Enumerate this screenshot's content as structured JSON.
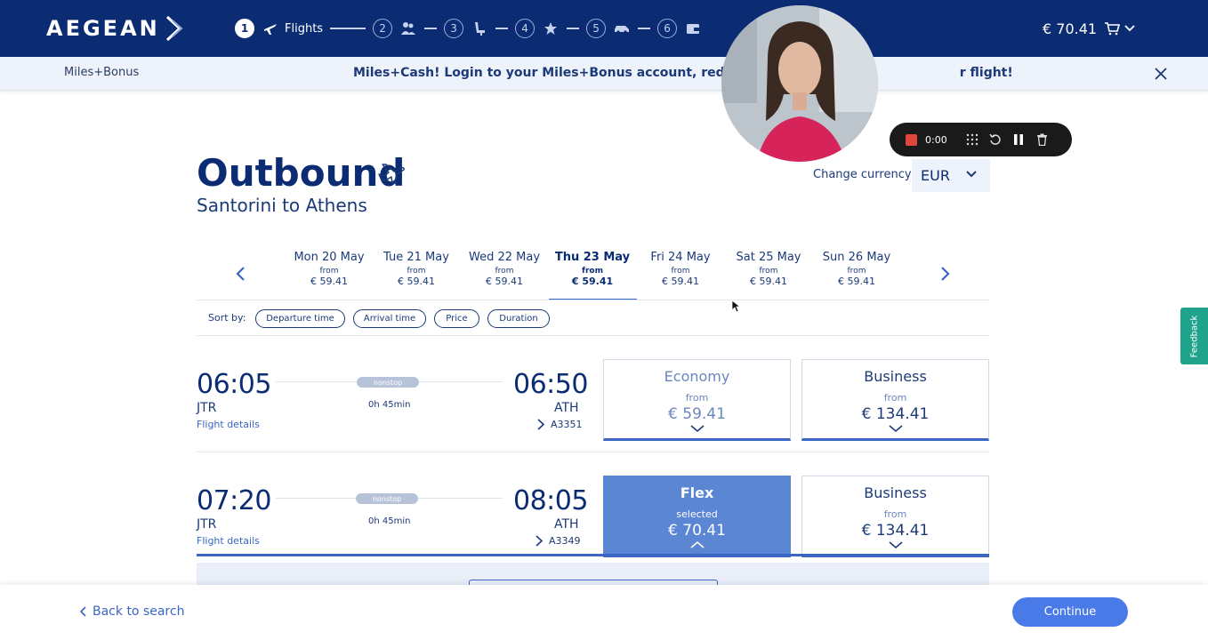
{
  "header": {
    "brand": "AEGEAN",
    "steps": [
      {
        "number": "1",
        "label": "Flights",
        "icon": "plane-icon"
      },
      {
        "number": "2",
        "icon": "passengers-icon"
      },
      {
        "number": "3",
        "icon": "seat-icon"
      },
      {
        "number": "4",
        "icon": "star-icon"
      },
      {
        "number": "5",
        "icon": "car-icon"
      },
      {
        "number": "6",
        "icon": "wallet-icon"
      }
    ],
    "cart_total": "€ 70.41"
  },
  "banner": {
    "brand": "Miles+Bonus",
    "message": "Miles+Cash! Login to your Miles+Bonus account, redeem your",
    "message_end": "r flight!"
  },
  "recorder": {
    "time": "0:00"
  },
  "page": {
    "title": "Outbound",
    "route": "Santorini to Athens",
    "currency_label": "Change currency:",
    "currency_value": "EUR"
  },
  "dates": [
    {
      "label": "Mon 20 May",
      "from": "from",
      "price": "€ 59.41"
    },
    {
      "label": "Tue 21 May",
      "from": "from",
      "price": "€ 59.41"
    },
    {
      "label": "Wed 22 May",
      "from": "from",
      "price": "€ 59.41"
    },
    {
      "label": "Thu 23 May",
      "from": "from",
      "price": "€ 59.41",
      "selected": true
    },
    {
      "label": "Fri 24 May",
      "from": "from",
      "price": "€ 59.41"
    },
    {
      "label": "Sat 25 May",
      "from": "from",
      "price": "€ 59.41"
    },
    {
      "label": "Sun 26 May",
      "from": "from",
      "price": "€ 59.41"
    }
  ],
  "sort": {
    "label": "Sort by:",
    "options": [
      "Departure time",
      "Arrival time",
      "Price",
      "Duration"
    ]
  },
  "flights": [
    {
      "dep_time": "06:05",
      "dep_code": "JTR",
      "details_link": "Flight details",
      "stops": "nonstop",
      "duration": "0h 45min",
      "arr_time": "06:50",
      "arr_code": "ATH",
      "flight_number": "A3351",
      "fares": [
        {
          "name": "Economy",
          "sub": "from",
          "price": "€ 59.41"
        },
        {
          "name": "Business",
          "sub": "from",
          "price": "€ 134.41"
        }
      ]
    },
    {
      "dep_time": "07:20",
      "dep_code": "JTR",
      "details_link": "Flight details",
      "stops": "nonstop",
      "duration": "0h 45min",
      "arr_time": "08:05",
      "arr_code": "ATH",
      "flight_number": "A3349",
      "fares": [
        {
          "name": "Flex",
          "sub": "selected",
          "price": "€ 70.41"
        },
        {
          "name": "Business",
          "sub": "from",
          "price": "€ 134.41"
        }
      ]
    }
  ],
  "footer": {
    "back": "Back to search",
    "continue": "Continue"
  },
  "feedback": "Feedback",
  "colors": {
    "navy": "#0b2c73",
    "accent": "#3b66c4",
    "selected_fare": "#5a86d4",
    "continue_button": "#4a7ae8",
    "feedback_tab": "#1fa38a"
  }
}
